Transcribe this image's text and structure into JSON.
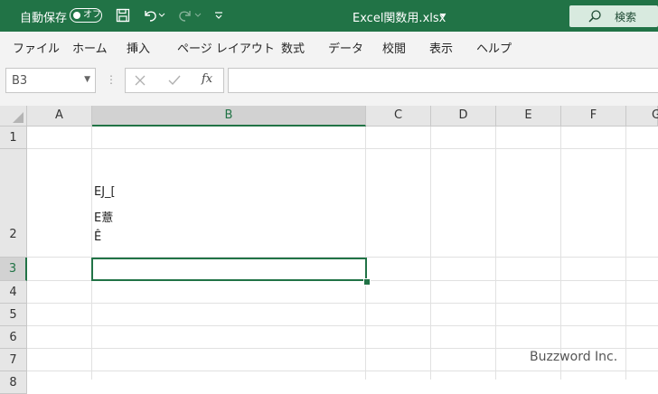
{
  "titlebar": {
    "autosave_label": "自動保存",
    "autosave_state": "オフ",
    "file_title": "Excel関数用.xlsx",
    "search_label": "検索",
    "accent": "#217346"
  },
  "ribbon": {
    "tabs": [
      "ファイル",
      "ホーム",
      "挿入",
      "ページ レイアウト",
      "数式",
      "データ",
      "校閲",
      "表示",
      "ヘルプ"
    ]
  },
  "formula_bar": {
    "name_box": "B3",
    "fx_label": "fx",
    "formula": ""
  },
  "sheet": {
    "columns": [
      "A",
      "B",
      "C",
      "D",
      "E",
      "F",
      "G"
    ],
    "rows": [
      "1",
      "2",
      "3",
      "4",
      "5",
      "6",
      "7",
      "8"
    ],
    "selected_cell": "B3",
    "cell_b2_lines": [
      "EJ_[",
      "E薏",
      "Ê"
    ]
  },
  "watermark": "Buzzword Inc."
}
